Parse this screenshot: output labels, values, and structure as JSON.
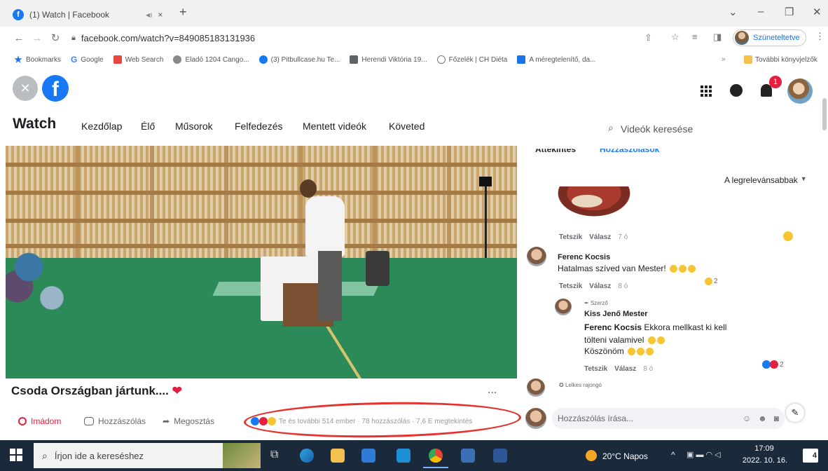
{
  "browser": {
    "tab_title": "(1) Watch | Facebook",
    "tab_close": "×",
    "new_tab": "+",
    "url": "facebook.com/watch?v=849085183131936",
    "profile_label": "Szüneteltetve",
    "other_bookmarks": "További könyvjelzők",
    "bookmarks": [
      {
        "label": "Bookmarks",
        "color": "#1a73e8"
      },
      {
        "label": "Google",
        "color": "#34a853"
      },
      {
        "label": "Web Search",
        "color": "#e8453c"
      },
      {
        "label": "Eladó 1204 Cango...",
        "color": "#888888"
      },
      {
        "label": "(3) Pitbullcase.hu Te...",
        "color": "#1877f2"
      },
      {
        "label": "Herendi Viktória 19...",
        "color": "#5f6368"
      },
      {
        "label": "Főzelék | CH Diéta",
        "color": "#777777"
      },
      {
        "label": "A méregtelenítő, da...",
        "color": "#1a73e8"
      }
    ]
  },
  "header": {
    "notification_count": "1"
  },
  "nav": {
    "brand": "Watch",
    "items": [
      "Kezdőlap",
      "Élő",
      "Műsorok",
      "Felfedezés",
      "Mentett videók",
      "Követed"
    ],
    "search_placeholder": "Videók keresése"
  },
  "video": {
    "title": "Csoda Országban jártunk....",
    "more": "...",
    "actions": {
      "like": "Imádom",
      "comment": "Hozzászólás",
      "share": "Megosztás"
    },
    "stats": "Te és további 514 ember · 78 hozzászólás · 7,6 E megtekintés"
  },
  "comments_panel": {
    "tabs": [
      "Áttekintés",
      "Hozzászólások"
    ],
    "sort": "A legrelevánsabbak",
    "like": "Tetszik",
    "reply": "Válasz",
    "comments": [
      {
        "time": "7 ó"
      },
      {
        "author": "Ferenc Kocsis",
        "text": "Hatalmas szíved van Mester!",
        "time": "8 ó",
        "reactions": "2"
      },
      {
        "badge": "Szerző",
        "author": "Kiss Jenő Mester",
        "mention": "Ferenc Kocsis",
        "text": "Ekkora mellkast ki kell tölteni valamivel",
        "text2": "Köszönöm",
        "time": "8 ó",
        "reactions": "2"
      },
      {
        "badge": "Lelkes rajongó"
      }
    ],
    "write_placeholder": "Hozzászólás írása..."
  },
  "taskbar": {
    "search_placeholder": "Írjon ide a kereséshez",
    "weather": "20°C  Napos",
    "time": "17:09",
    "date": "2022. 10. 16.",
    "notif_count": "4"
  }
}
